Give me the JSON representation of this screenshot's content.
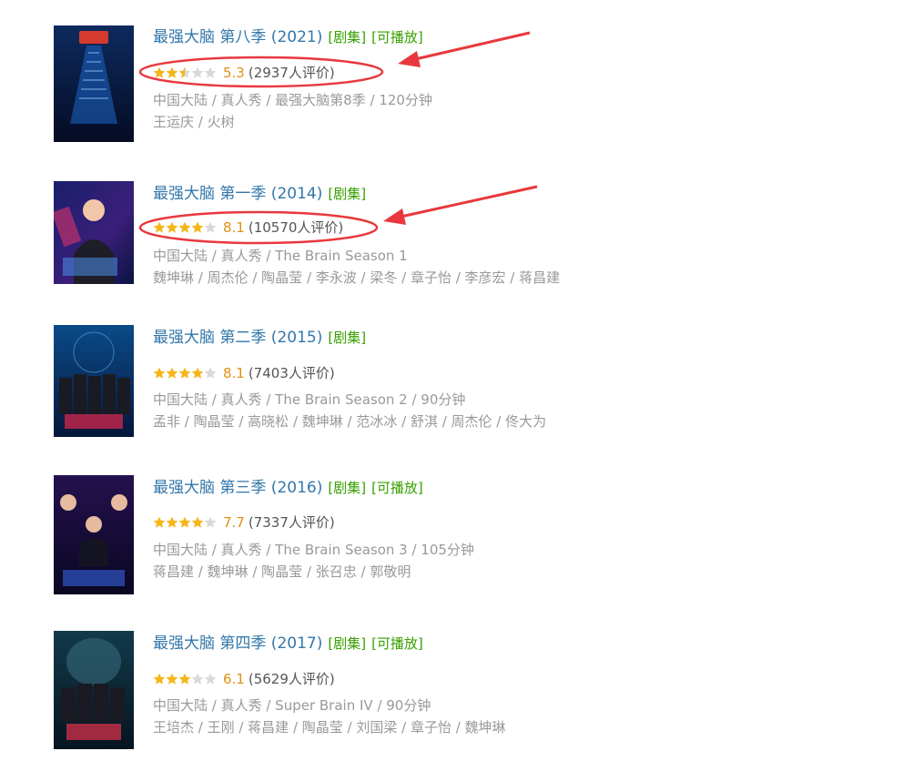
{
  "colors": {
    "title": "#3377aa",
    "tag": "#37a000",
    "star_on": "#f5b619",
    "star_off": "#d9d9d9",
    "score": "#e09015",
    "meta": "#999999",
    "annotation": "#e8383d"
  },
  "results": [
    {
      "title": "最强大脑 第八季 (2021)",
      "tags": [
        "[剧集]",
        "[可播放]"
      ],
      "stars": 2.5,
      "score": "5.3",
      "votes": "(2937人评价)",
      "meta": "中国大陆 / 真人秀 / 最强大脑第8季 / 120分钟",
      "cast": "王运庆 / 火树",
      "poster_icon": "poster-image",
      "poster_text": "去登顶 去闪耀",
      "highlighted": true
    },
    {
      "title": "最强大脑 第一季 (2014)",
      "tags": [
        "[剧集]"
      ],
      "stars": 4,
      "score": "8.1",
      "votes": "(10570人评价)",
      "meta": "中国大陆 / 真人秀 / The Brain Season 1",
      "cast": "魏坤琳 / 周杰伦 / 陶晶莹 / 李永波 / 梁冬 / 章子怡 / 李彦宏 / 蒋昌建",
      "poster_icon": "poster-image",
      "poster_text": "最强大脑",
      "highlighted": true
    },
    {
      "title": "最强大脑 第二季 (2015)",
      "tags": [
        "[剧集]"
      ],
      "stars": 4,
      "score": "8.1",
      "votes": "(7403人评价)",
      "meta": "中国大陆 / 真人秀 / The Brain Season 2 / 90分钟",
      "cast": "孟非 / 陶晶莹 / 高晓松 / 魏坤琳 / 范冰冰 / 舒淇 / 周杰伦 / 佟大为",
      "poster_icon": "poster-image",
      "poster_text": "最强大脑",
      "highlighted": false
    },
    {
      "title": "最强大脑 第三季 (2016)",
      "tags": [
        "[剧集]",
        "[可播放]"
      ],
      "stars": 4,
      "score": "7.7",
      "votes": "(7337人评价)",
      "meta": "中国大陆 / 真人秀 / The Brain Season 3 / 105分钟",
      "cast": "蒋昌建 / 魏坤琳 / 陶晶莹 / 张召忠 / 郭敬明",
      "poster_icon": "poster-image",
      "poster_text": "最强大脑",
      "highlighted": false
    },
    {
      "title": "最强大脑 第四季 (2017)",
      "tags": [
        "[剧集]",
        "[可播放]"
      ],
      "stars": 3,
      "score": "6.1",
      "votes": "(5629人评价)",
      "meta": "中国大陆 / 真人秀 / Super Brain IV / 90分钟",
      "cast": "王培杰 / 王刚 / 蒋昌建 / 陶晶莹 / 刘国梁 / 章子怡 / 魏坤琳",
      "poster_icon": "poster-image",
      "poster_text": "最强大脑",
      "highlighted": false
    }
  ]
}
